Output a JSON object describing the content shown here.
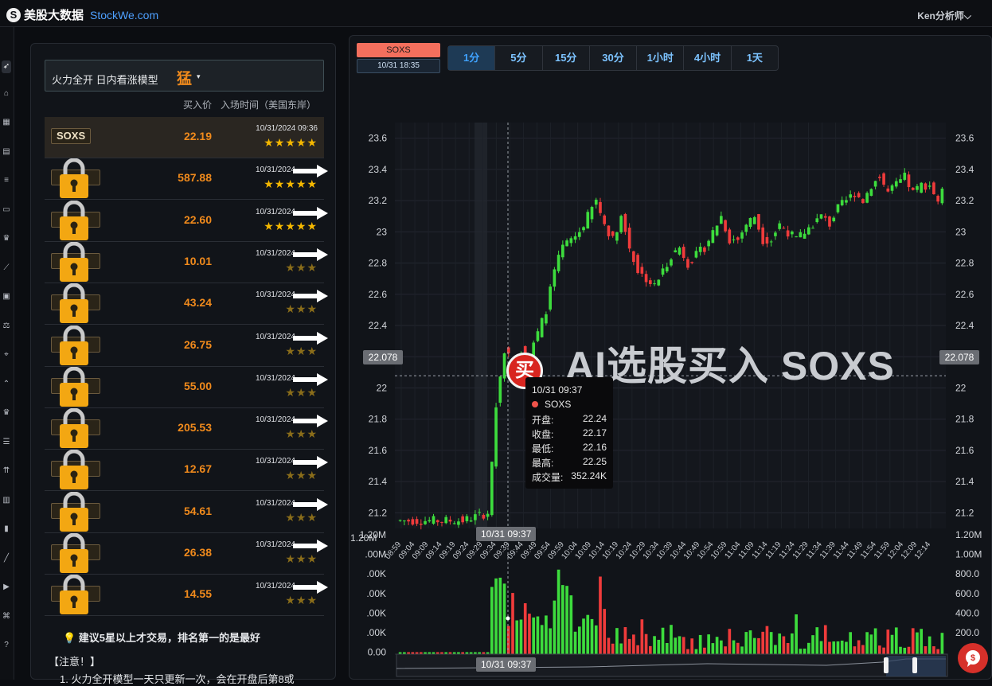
{
  "topbar": {
    "logo_mark": "S",
    "logo_text": "美股大数据",
    "logo_domain": "StockWe.com",
    "user": "Ken分析师⌵"
  },
  "sidebar": {
    "icons": [
      "rocket-icon",
      "robot-icon",
      "dashboard-icon",
      "chart-bar-icon",
      "list-icon",
      "table-icon",
      "crown-icon",
      "trend-line-icon",
      "calendar-icon",
      "balance-icon",
      "hierarchy-icon",
      "wave-icon",
      "crown-icon",
      "sort-icon",
      "bullish-icon",
      "volume-icon",
      "candle-icon",
      "line-icon",
      "video-icon",
      "link-icon",
      "help-icon"
    ]
  },
  "model": {
    "label": "火力全开 日内看涨模型",
    "value": "猛",
    "arrow": "▾"
  },
  "table_header": {
    "price": "买入价",
    "time": "入场时间（美国东岸）"
  },
  "rows": [
    {
      "ticker": "SOXS",
      "price": "22.19",
      "time": "10/31/2024 09:36",
      "stars": "★★★★★",
      "locked": false
    },
    {
      "ticker": "",
      "price": "587.88",
      "time": "10/31/2024",
      "stars": "★★★★★",
      "locked": true
    },
    {
      "ticker": "",
      "price": "22.60",
      "time": "10/31/2024",
      "stars": "★★★★★",
      "locked": true
    },
    {
      "ticker": "",
      "price": "10.01",
      "time": "10/31/2024",
      "stars": "★★★",
      "locked": true
    },
    {
      "ticker": "",
      "price": "43.24",
      "time": "10/31/2024",
      "stars": "★★★",
      "locked": true
    },
    {
      "ticker": "",
      "price": "26.75",
      "time": "10/31/2024",
      "stars": "★★★",
      "locked": true
    },
    {
      "ticker": "",
      "price": "55.00",
      "time": "10/31/2024",
      "stars": "★★★",
      "locked": true
    },
    {
      "ticker": "",
      "price": "205.53",
      "time": "10/31/2024",
      "stars": "★★★",
      "locked": true
    },
    {
      "ticker": "",
      "price": "12.67",
      "time": "10/31/2024",
      "stars": "★★★",
      "locked": true
    },
    {
      "ticker": "",
      "price": "54.61",
      "time": "10/31/2024",
      "stars": "★★★",
      "locked": true
    },
    {
      "ticker": "",
      "price": "26.38",
      "time": "10/31/2024",
      "stars": "★★★",
      "locked": true
    },
    {
      "ticker": "",
      "price": "14.55",
      "time": "10/31/2024",
      "stars": "★★★",
      "locked": true
    }
  ],
  "tip": "💡   建议5星以上才交易，排名第一的是最好",
  "notes": {
    "title": "【注意！】",
    "item1": "1.  火力全开模型一天只更新一次，会在开盘后第8或"
  },
  "symbol": {
    "name": "SOXS",
    "time": "10/31 18:35"
  },
  "timeframes": [
    "1分",
    "5分",
    "15分",
    "30分",
    "1小时",
    "4小时",
    "1天"
  ],
  "crosshair": {
    "price": "22.078",
    "time": "10/31 09:37"
  },
  "watermark": "AI选股买入 SOXS",
  "buy_marker": "买",
  "tooltip": {
    "time": "10/31 09:37",
    "series": "SOXS",
    "rows": [
      [
        "开盘:",
        "22.24"
      ],
      [
        "收盘:",
        "22.17"
      ],
      [
        "最低:",
        "22.16"
      ],
      [
        "最高:",
        "22.25"
      ],
      [
        "成交量:",
        "352.24K"
      ]
    ]
  },
  "colors": {
    "up": "#3ddc3d",
    "down": "#ef3b3b",
    "accent": "#f08a1c",
    "star": "#f5b800"
  },
  "chart_data": {
    "type": "candlestick",
    "series": "SOXS",
    "price_ticks": [
      "23.6",
      "23.4",
      "23.2",
      "23",
      "22.8",
      "22.6",
      "22.4",
      "22.2",
      "22",
      "21.8",
      "21.6",
      "21.4",
      "21.2"
    ],
    "volume_ticks_left": [
      "1.20M",
      ".00M",
      ".00K",
      ".00K",
      ".00K",
      ".00K",
      "0.00"
    ],
    "volume_ticks_right": [
      "1.20M",
      "1.00M",
      "800.0",
      "600.0",
      "400.0",
      "200.0"
    ],
    "x_ticks": [
      "08:59",
      "09:04",
      "09:09",
      "09:14",
      "09:19",
      "09:24",
      "09:29",
      "09:34",
      "09:39",
      "09:44",
      "09:49",
      "09:54",
      "09:59",
      "10:04",
      "10:09",
      "10:14",
      "10:19",
      "10:24",
      "10:29",
      "10:34",
      "10:39",
      "10:44",
      "10:49",
      "10:54",
      "10:59",
      "11:04",
      "11:09",
      "11:14",
      "11:19",
      "11:24",
      "11:29",
      "11:34",
      "11:39",
      "11:44",
      "11:49",
      "11:54",
      "11:59",
      "12:04",
      "12:09",
      "12:14"
    ],
    "ylim": [
      21.1,
      23.7
    ],
    "path": [
      [
        0,
        21.15
      ],
      [
        16,
        21.15
      ],
      [
        22,
        21.2
      ],
      [
        23,
        21.5
      ],
      [
        24,
        21.9
      ],
      [
        26,
        22.25
      ],
      [
        28,
        22.15
      ],
      [
        30,
        22.25
      ],
      [
        32,
        22.2
      ],
      [
        34,
        22.35
      ],
      [
        36,
        22.5
      ],
      [
        38,
        22.75
      ],
      [
        40,
        22.9
      ],
      [
        42,
        22.95
      ],
      [
        44,
        23.0
      ],
      [
        46,
        23.1
      ],
      [
        48,
        23.2
      ],
      [
        50,
        23.05
      ],
      [
        52,
        22.95
      ],
      [
        54,
        23.1
      ],
      [
        56,
        22.9
      ],
      [
        58,
        22.75
      ],
      [
        60,
        22.7
      ],
      [
        62,
        22.65
      ],
      [
        64,
        22.75
      ],
      [
        66,
        22.85
      ],
      [
        68,
        22.9
      ],
      [
        70,
        22.8
      ],
      [
        72,
        22.85
      ],
      [
        74,
        22.9
      ],
      [
        76,
        23.0
      ],
      [
        78,
        23.1
      ],
      [
        80,
        22.95
      ],
      [
        82,
        22.95
      ],
      [
        84,
        23.05
      ],
      [
        86,
        23.1
      ],
      [
        88,
        22.95
      ],
      [
        90,
        22.95
      ],
      [
        92,
        23.05
      ],
      [
        94,
        23.0
      ],
      [
        96,
        22.95
      ],
      [
        98,
        23.0
      ],
      [
        100,
        23.05
      ],
      [
        102,
        23.1
      ],
      [
        104,
        23.05
      ],
      [
        106,
        23.15
      ],
      [
        108,
        23.2
      ],
      [
        110,
        23.25
      ],
      [
        112,
        23.2
      ],
      [
        114,
        23.3
      ],
      [
        116,
        23.35
      ],
      [
        118,
        23.25
      ],
      [
        120,
        23.3
      ],
      [
        122,
        23.35
      ],
      [
        124,
        23.25
      ],
      [
        126,
        23.3
      ],
      [
        128,
        23.3
      ],
      [
        130,
        23.2
      ],
      [
        131,
        23.25
      ]
    ]
  }
}
